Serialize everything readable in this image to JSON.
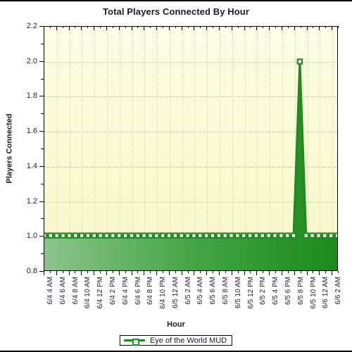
{
  "chart_data": {
    "type": "area",
    "title": "Total Players Connected By Hour",
    "xlabel": "Hour",
    "ylabel": "Players Connected",
    "ylim": [
      0.8,
      2.2
    ],
    "ytick_step": 0.2,
    "ytick_labels": [
      "0.8",
      "1.0",
      "1.2",
      "1.4",
      "1.6",
      "1.8",
      "2.0",
      "2.2"
    ],
    "grid": true,
    "legend_position": "bottom",
    "series": [
      {
        "name": "Eye of the World MUD",
        "line_color": "#1e8b1e",
        "fill_color_left": "#86c186",
        "fill_color_right": "#1b8a1b",
        "marker": "open-square",
        "marker_fill": "#ffffff",
        "values": [
          1,
          1,
          1,
          1,
          1,
          1,
          1,
          1,
          1,
          1,
          1,
          1,
          1,
          1,
          1,
          1,
          1,
          1,
          1,
          1,
          1,
          1,
          1,
          1,
          1,
          1,
          1,
          1,
          1,
          1,
          1,
          1,
          1,
          1,
          1,
          1,
          1,
          1,
          1,
          1,
          1,
          2,
          1,
          1,
          1,
          1,
          1,
          1
        ]
      }
    ],
    "x": [
      "6/4 4 AM",
      "6/4 5 AM",
      "6/4 6 AM",
      "6/4 7 AM",
      "6/4 8 AM",
      "6/4 9 AM",
      "6/4 10 AM",
      "6/4 11 AM",
      "6/4 12 PM",
      "6/4 1 PM",
      "6/4 2 PM",
      "6/4 3 PM",
      "6/4 4 PM",
      "6/4 5 PM",
      "6/4 6 PM",
      "6/4 7 PM",
      "6/4 8 PM",
      "6/4 9 PM",
      "6/4 10 PM",
      "6/4 11 PM",
      "6/5 12 AM",
      "6/5 1 AM",
      "6/5 2 AM",
      "6/5 3 AM",
      "6/5 4 AM",
      "6/5 5 AM",
      "6/5 6 AM",
      "6/5 7 AM",
      "6/5 8 AM",
      "6/5 9 AM",
      "6/5 10 AM",
      "6/5 11 AM",
      "6/5 12 PM",
      "6/5 1 PM",
      "6/5 2 PM",
      "6/5 3 PM",
      "6/5 4 PM",
      "6/5 5 PM",
      "6/5 6 PM",
      "6/5 7 PM",
      "6/5 8 PM",
      "6/5 9 PM",
      "6/5 10 PM",
      "6/5 11 PM",
      "6/6 12 AM",
      "6/6 1 AM",
      "6/6 2 AM",
      "6/6 3 AM"
    ],
    "xtick_labels": [
      "6/4 4 AM",
      "6/4 6 AM",
      "6/4 8 AM",
      "6/4 10 AM",
      "6/4 12 PM",
      "6/4 2 PM",
      "6/4 4 PM",
      "6/4 6 PM",
      "6/4 8 PM",
      "6/4 10 PM",
      "6/5 12 AM",
      "6/5 2 AM",
      "6/5 4 AM",
      "6/5 6 AM",
      "6/5 8 AM",
      "6/5 10 AM",
      "6/5 12 PM",
      "6/5 2 PM",
      "6/5 4 PM",
      "6/5 6 PM",
      "6/5 8 PM",
      "6/5 10 PM",
      "6/6 12 AM",
      "6/6 2 AM"
    ],
    "peak": {
      "x": "6/5 8 PM",
      "y": 2.0
    }
  },
  "legend": {
    "entries": [
      {
        "label": "Eye of the World MUD"
      }
    ]
  }
}
